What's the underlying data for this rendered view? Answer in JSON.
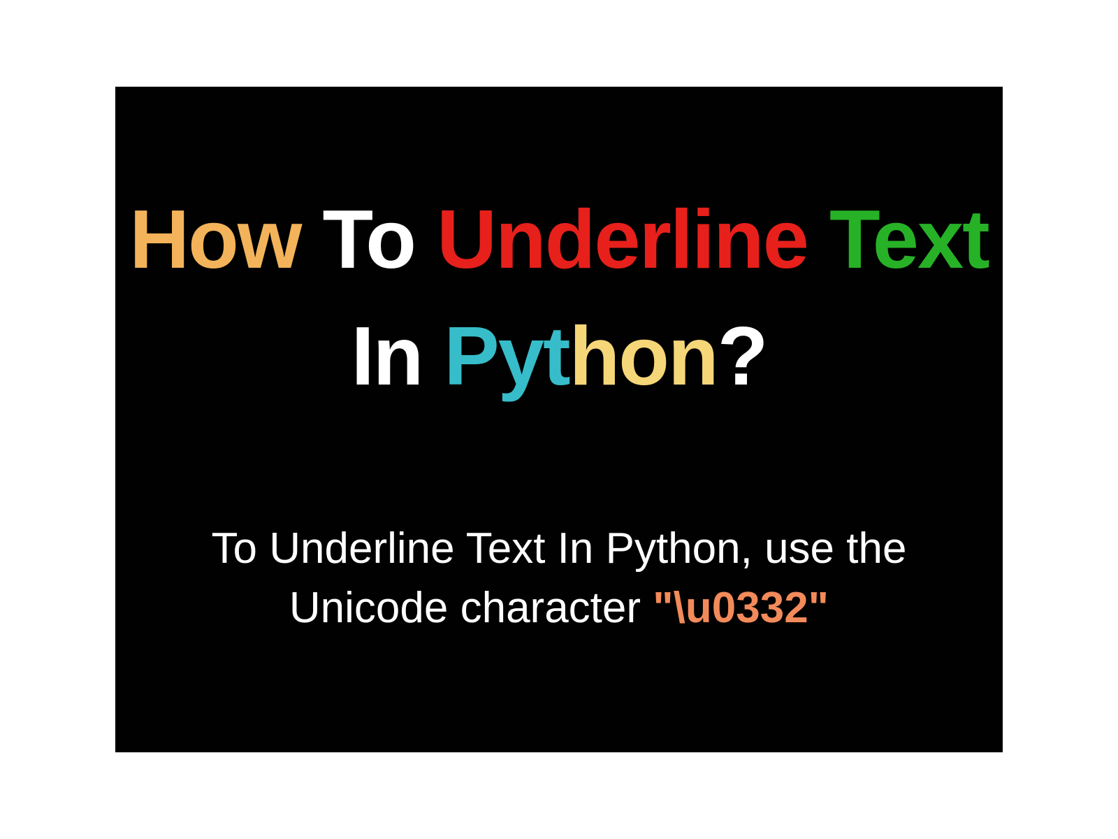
{
  "title": {
    "word1": "How",
    "word2": "To",
    "word3": "Underline",
    "word4": "Text",
    "word5": "In",
    "word6a": "Pyt",
    "word6b": "hon",
    "qmark": "?"
  },
  "subtitle": {
    "line1": "To Underline Text In Python, use the",
    "line2a": "Unicode character ",
    "line2b": "\"\\u0332\""
  }
}
